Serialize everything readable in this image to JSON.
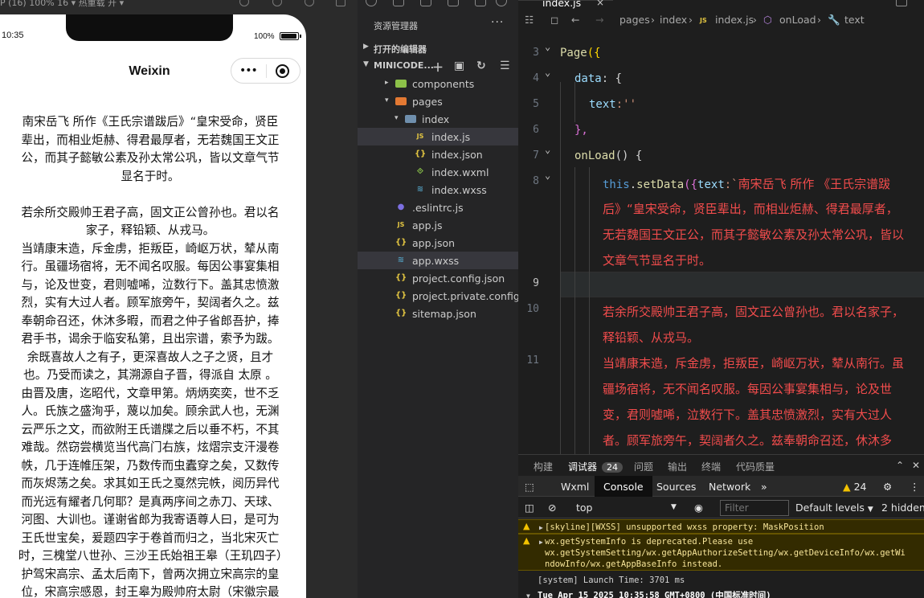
{
  "simulator": {
    "topbar_label": "P (16) 100% 16 ▾   热重载 开 ▾",
    "status_time": "10:35",
    "battery_text": "100%",
    "battery_level": 1.0,
    "nav_title": "Weixin",
    "capsule": {
      "menu_icon": "more-dots-icon",
      "close_icon": "record-circle-icon"
    },
    "page_text": "南宋岳飞 所作《王氏宗谱跋后》“皇宋受命，贤臣辈出，而相业炬赫、得君最厚者，无若魏国王文正公，而其子懿敏公素及孙太常公巩，皆以文章气节显名于时。\n\n若余所交殿帅王君子高，固文正公曾孙也。君以名家子，释铅颖、从戎马。\n当靖康末造，斥金虏，拒叛臣，崎岖万状，辇从南行。虽疆场宿将，无不闻名叹服。每因公事宴集相与，论及世变，君则嘘唏，泣数行下。盖其忠愤激烈，实有大过人者。顾军旅旁午，契阔者久之。兹奉朝命召还，休沐多暇，而君之仲子省郎吾护，捧君手书，谒余于临安私第，且出宗谱，索予为跋。余既喜故人之有子，更深喜故人之子之贤，且才也。乃受而读之，其溯源自子晋，得派自 太原 。由晋及唐，迄昭代，文章甲第。炳炳奕奕，世不乏人。氏族之盛洵乎，蔑以加矣。顾余武人也，无渊云严乐之文，而欲附王氏谱牒之后以垂不朽，不其难哉。然窃尝横览当代高门右族，炫熠宗支汗漫卷帙，几于连帷压架，乃数传而虫蠹穿之矣，又数传而灰烬荡之矣。求其如王氏之戛然完帙，阅历异代而光远有耀者几何耶？是真两序间之赤刀、天球、河图、大训也。谨谢省郎为我寄语尊人曰，是可为王氏世宝矣，爰题四字于卷首而归之，当北宋灭亡时，三槐堂八世孙、三沙王氏始祖王皋（王玑四子）护驾宋高宗、孟太后南下，曾两次拥立宋高宗的皇位，宋高宗感恩，封王皋为殿帅府太尉（宋徽宗最"
  },
  "explorer": {
    "title": "资源管理器",
    "more": "···",
    "open_editors": "打开的编辑器",
    "project": "MINICODE...",
    "tree": [
      {
        "label": "components",
        "depth": 1,
        "kind": "folder-g",
        "twisty": "▸"
      },
      {
        "label": "pages",
        "depth": 1,
        "kind": "folder-o",
        "twisty": "▾"
      },
      {
        "label": "index",
        "depth": 2,
        "kind": "folder-b",
        "twisty": "▾"
      },
      {
        "label": "index.js",
        "depth": 3,
        "kind": "js",
        "selected": true
      },
      {
        "label": "index.json",
        "depth": 3,
        "kind": "json"
      },
      {
        "label": "index.wxml",
        "depth": 3,
        "kind": "wxml"
      },
      {
        "label": "index.wxss",
        "depth": 3,
        "kind": "wxss"
      },
      {
        "label": ".eslintrc.js",
        "depth": 1,
        "kind": "eslint"
      },
      {
        "label": "app.js",
        "depth": 1,
        "kind": "js"
      },
      {
        "label": "app.json",
        "depth": 1,
        "kind": "json"
      },
      {
        "label": "app.wxss",
        "depth": 1,
        "kind": "wxss",
        "selected": true
      },
      {
        "label": "project.config.json",
        "depth": 1,
        "kind": "json"
      },
      {
        "label": "project.private.config.js...",
        "depth": 1,
        "kind": "json"
      },
      {
        "label": "sitemap.json",
        "depth": 1,
        "kind": "json"
      }
    ]
  },
  "editor": {
    "tab_name": "index.js",
    "tab_close": "×",
    "breadcrumb": [
      "pages",
      "index",
      "index.js",
      "onLoad",
      "text"
    ],
    "line_numbers": [
      "3",
      "4",
      "5",
      "6",
      "7",
      "8",
      "9",
      "10",
      "11"
    ],
    "code": {
      "l3_fn": "Page",
      "l3_rest": "({",
      "l4_key": "data",
      "l4_rest": ": {",
      "l5_key": "text",
      "l5_rest": ":''",
      "l6": "},",
      "l7_fn": "onLoad",
      "l7_rest": "() {",
      "l8_this": "this",
      "l8_dot": ".",
      "l8_fn": "setData",
      "l8_open": "({",
      "l8_key": "text",
      "l8_colon": ":`",
      "str_lines": [
        "南宋岳飞 所作 《王氏宗谱跋",
        "后》“皇宋受命，贤臣辈出，而相业炬赫、得君最厚者，",
        "无若魏国王文正公，而其子懿敏公素及孙太常公巩，皆以",
        "文章气节显名于时。"
      ],
      "str_lines_b": [
        "若余所交殿帅王君子高，固文正公曾孙也。君以名家子，",
        "释铅颖、从戎马。",
        "当靖康末造，斥金虏，拒叛臣，崎岖万状，辇从南行。虽",
        "疆场宿将，无不闻名叹服。每因公事宴集相与，论及世",
        "变，君则嘘唏，泣数行下。盖其忠愤激烈，实有大过人",
        "者。顾军旅旁午，契阔者久之。兹奉朝命召还，休沐多"
      ]
    }
  },
  "panel": {
    "tabs": [
      "构建",
      "调试器",
      "问题",
      "输出",
      "终端",
      "代码质量"
    ],
    "debugger_badge": "24",
    "devtools_tabs": [
      "Wxml",
      "Console",
      "Sources",
      "Network"
    ],
    "more_tabs": "»",
    "warn_count": "24",
    "context": "top",
    "filter_placeholder": "Filter",
    "levels": "Default levels",
    "hidden": "2 hidden",
    "logs": [
      {
        "type": "warn",
        "text": "[skyline][WXSS] unsupported wxss property: MaskPosition"
      },
      {
        "type": "warn",
        "text": "wx.getSystemInfo is deprecated.Please use\nwx.getSystemSetting/wx.getAppAuthorizeSetting/wx.getDeviceInfo/wx.getWi\nndowInfo/wx.getAppBaseInfo instead."
      },
      {
        "type": "plain",
        "text": "[system] Launch Time: 3701 ms"
      },
      {
        "type": "bold",
        "text": "Tue Apr 15 2025 10:35:58 GMT+0800 (中国标准时间)"
      }
    ]
  }
}
